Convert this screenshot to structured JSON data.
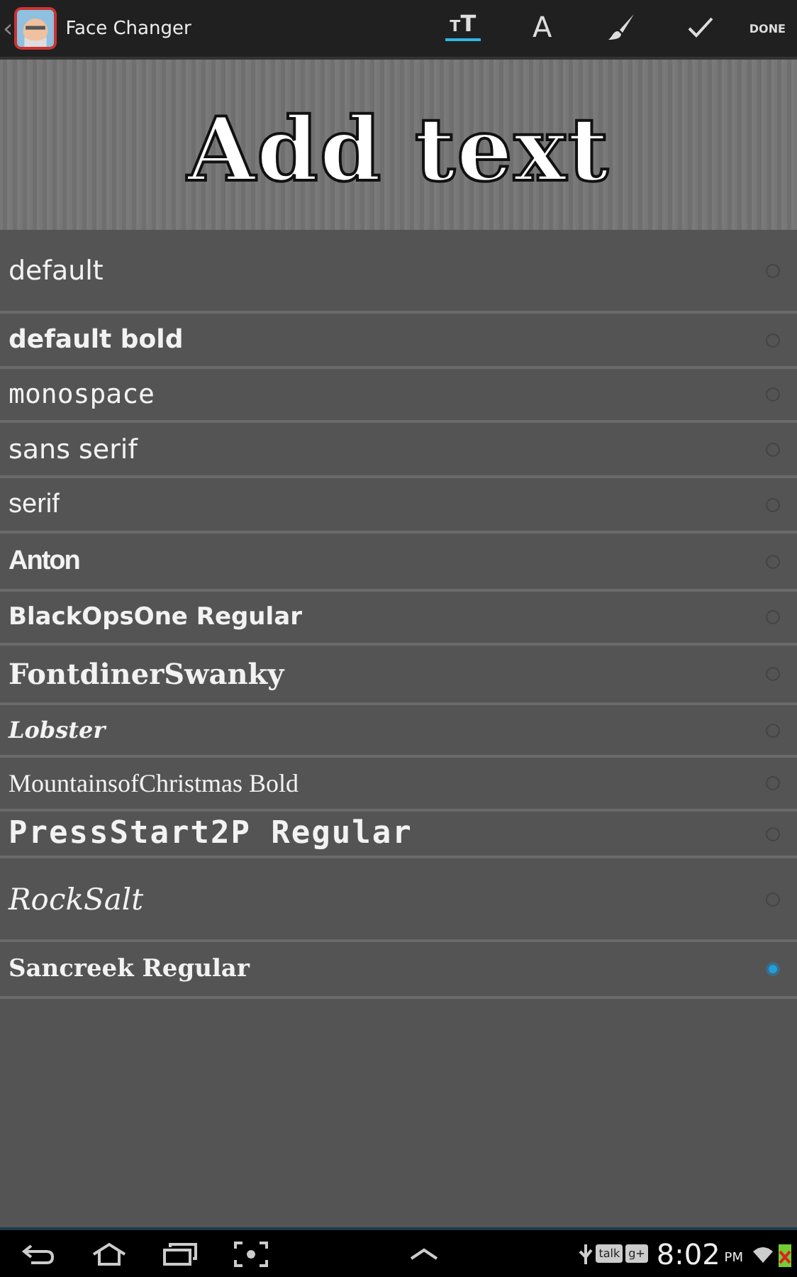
{
  "action_bar": {
    "back": "‹",
    "title": "Face Changer",
    "tools": [
      {
        "kind": "size",
        "label": "TT",
        "selected": true
      },
      {
        "kind": "font",
        "label": "A",
        "selected": false
      },
      {
        "kind": "brush",
        "selected": false
      },
      {
        "kind": "check",
        "selected": false
      }
    ],
    "done": "DONE"
  },
  "preview": {
    "text": "Add text"
  },
  "fonts": [
    {
      "name": "default",
      "kind": "plain",
      "selected": false
    },
    {
      "name": "default bold",
      "kind": "bold",
      "selected": false
    },
    {
      "name": "monospace",
      "kind": "mono",
      "selected": false
    },
    {
      "name": "sans serif",
      "kind": "sans",
      "selected": false
    },
    {
      "name": "serif",
      "kind": "serif",
      "selected": false
    },
    {
      "name": "Anton",
      "kind": "condensed",
      "selected": false
    },
    {
      "name": "BlackOpsOne Regular",
      "kind": "heavy",
      "selected": false
    },
    {
      "name": "FontdinerSwanky",
      "kind": "swanky",
      "selected": false
    },
    {
      "name": "Lobster",
      "kind": "script",
      "selected": false
    },
    {
      "name": "MountainsofChristmas Bold",
      "kind": "thin",
      "selected": false
    },
    {
      "name": "PressStart2P Regular",
      "kind": "pixel",
      "selected": false
    },
    {
      "name": "RockSalt",
      "kind": "hand",
      "selected": false
    },
    {
      "name": "Sancreek Regular",
      "kind": "western",
      "selected": true
    }
  ],
  "system_bar": {
    "status": [
      "talk",
      "g+"
    ],
    "time": "8:02",
    "ampm": "PM"
  }
}
